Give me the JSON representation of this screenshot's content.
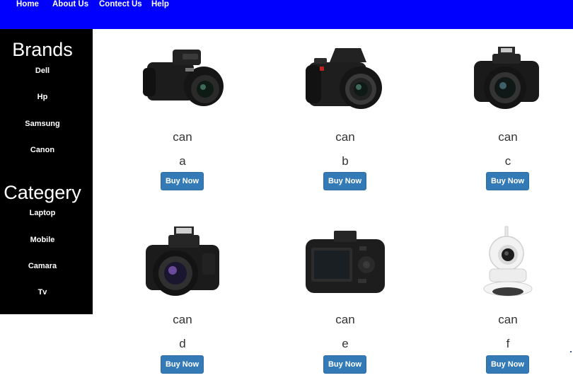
{
  "nav": {
    "links": [
      "Home",
      "About Us",
      "Contect Us",
      "Help"
    ]
  },
  "sidebar": {
    "brands_heading": "Brands",
    "brands": [
      "Dell",
      "Hp",
      "Samsung",
      "Canon"
    ],
    "category_heading": "Categery",
    "categories": [
      "Laptop",
      "Mobile",
      "Camara",
      "Tv"
    ]
  },
  "products": [
    {
      "name": "can",
      "code": "a",
      "button": "Buy Now",
      "image": "bridge-camera-nikon"
    },
    {
      "name": "can",
      "code": "b",
      "button": "Buy Now",
      "image": "dslr-nikon"
    },
    {
      "name": "can",
      "code": "c",
      "button": "Buy Now",
      "image": "bridge-camera-canon"
    },
    {
      "name": "can",
      "code": "d",
      "button": "Buy Now",
      "image": "bridge-camera-canon-flash"
    },
    {
      "name": "can",
      "code": "e",
      "button": "Buy Now",
      "image": "dslr-canon-back"
    },
    {
      "name": "can",
      "code": "f",
      "button": "Buy Now",
      "image": "ip-security-camera"
    }
  ],
  "colors": {
    "nav_bg": "#0000ff",
    "sidebar_bg": "#000000",
    "button_bg": "#337ab7",
    "product_text": "#333333"
  }
}
